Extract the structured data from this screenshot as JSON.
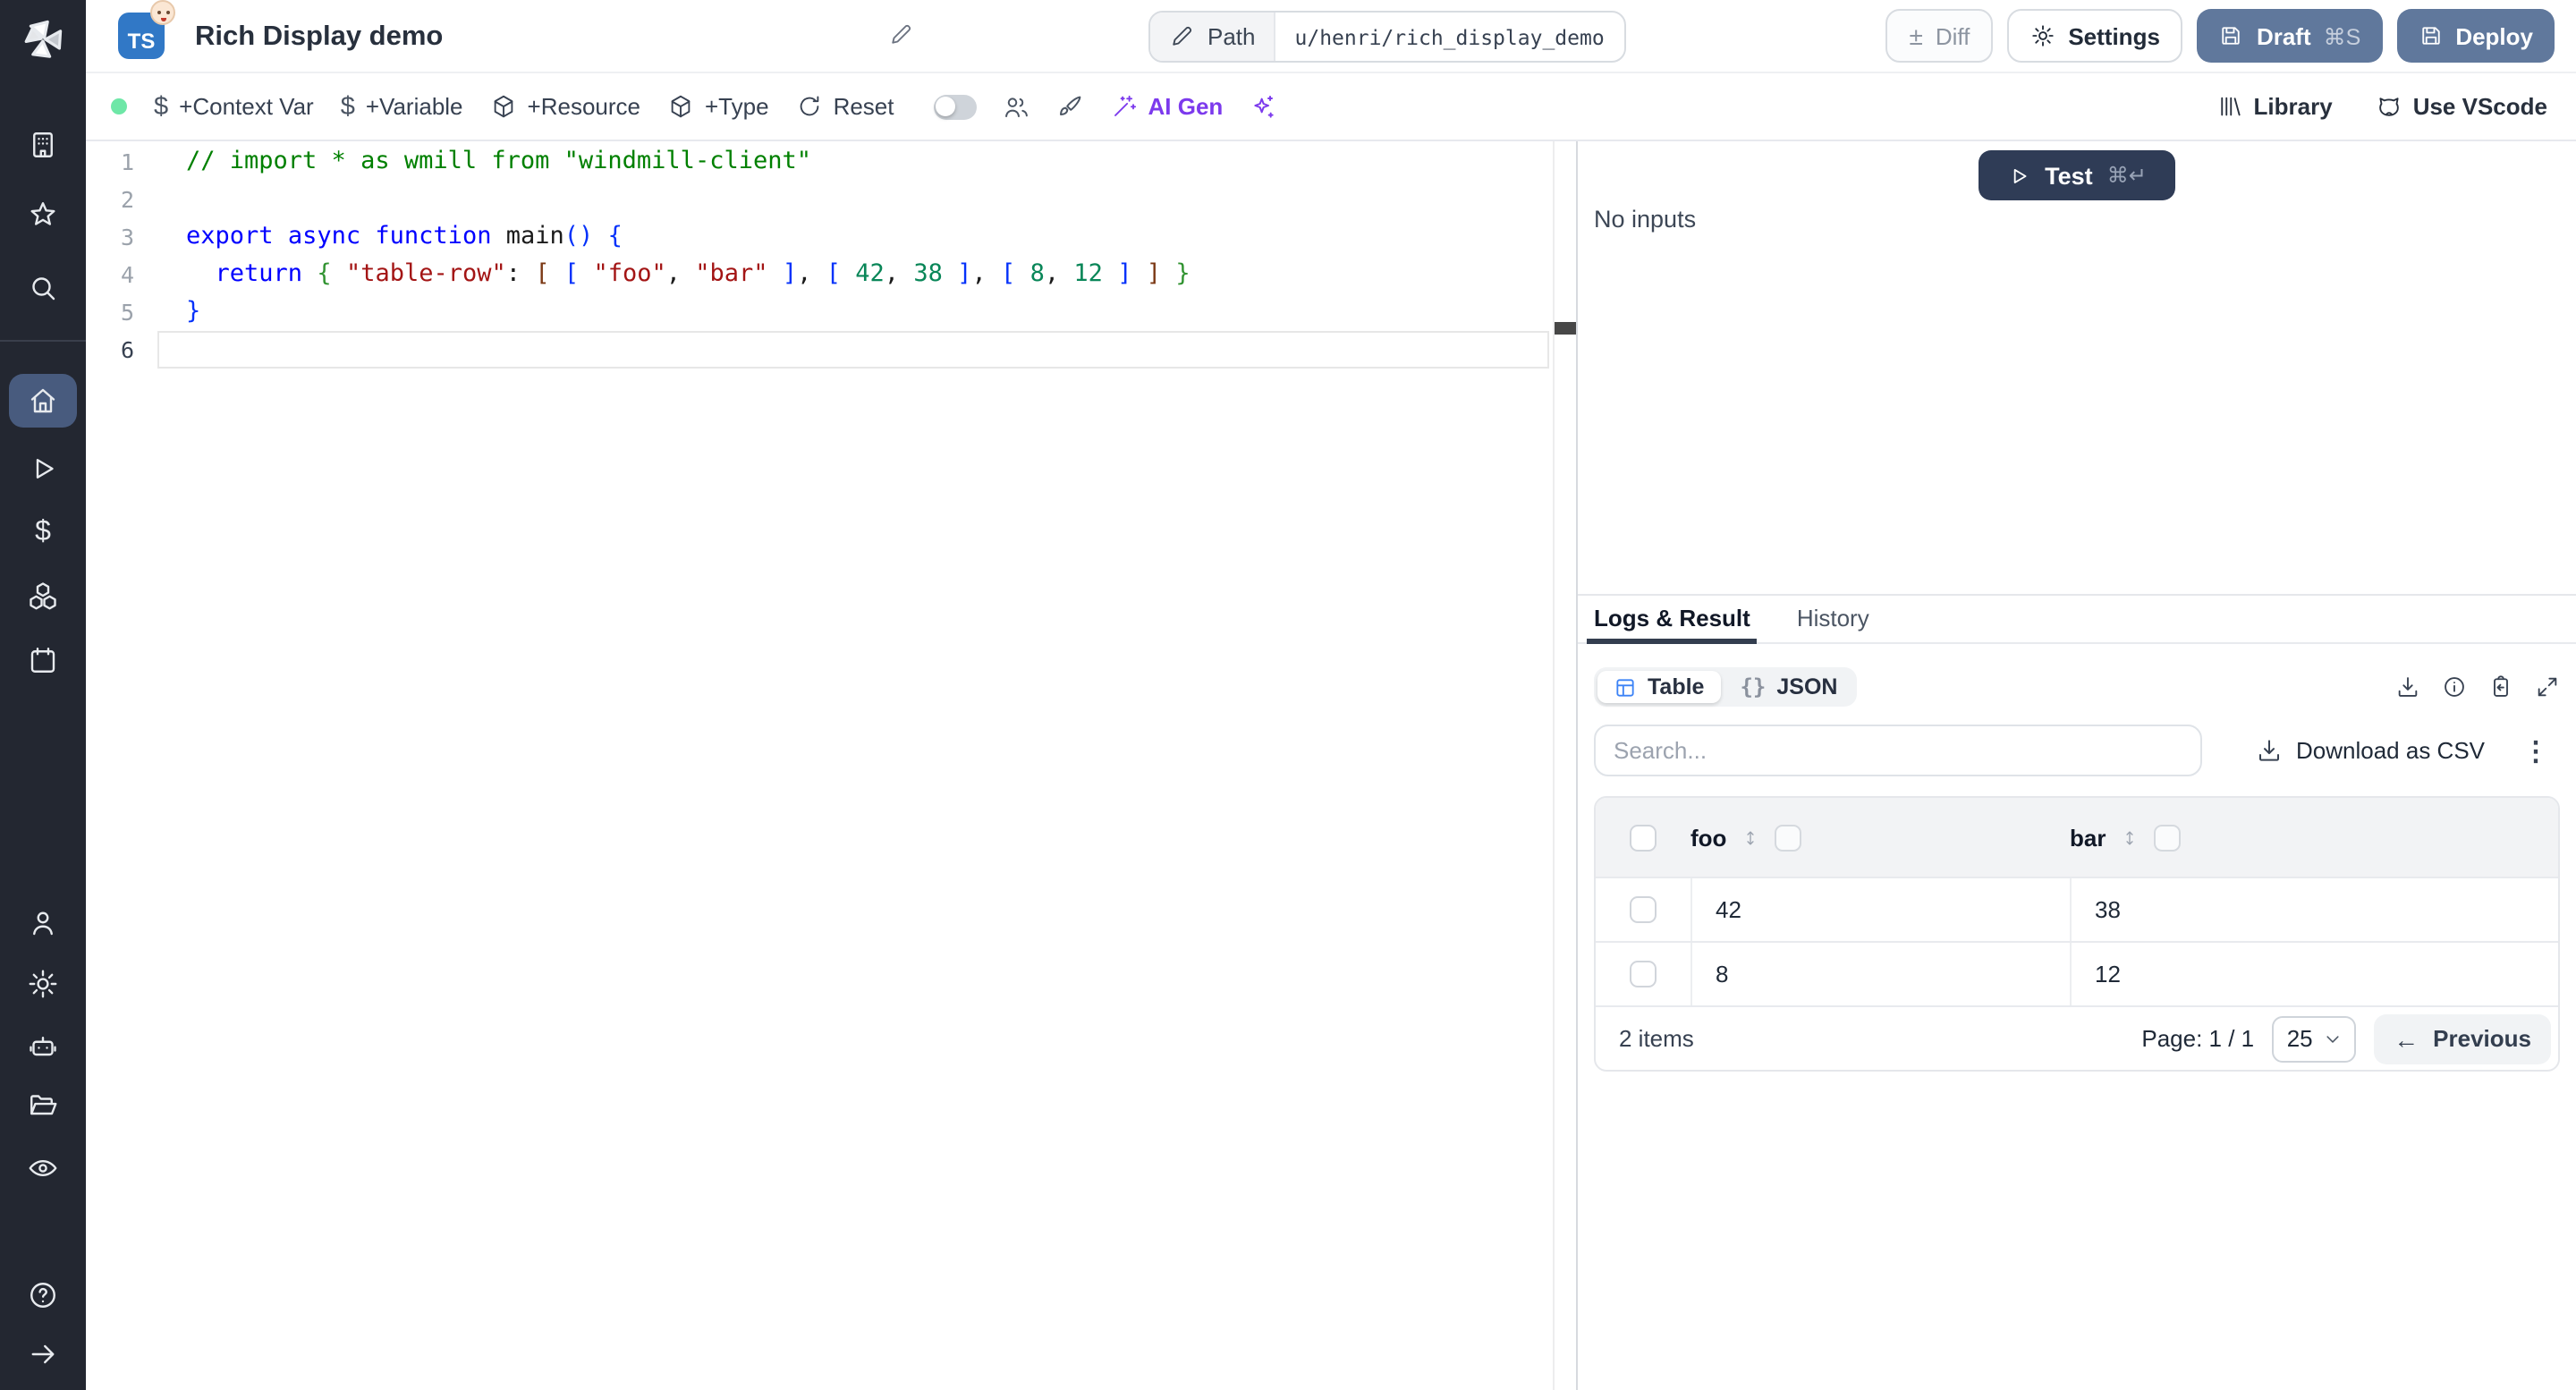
{
  "header": {
    "lang_badge": "TS",
    "title": "Rich Display demo",
    "path_label": "Path",
    "path_value": "u/henri/rich_display_demo",
    "diff_label": "Diff",
    "settings_label": "Settings",
    "draft_label": "Draft",
    "draft_shortcut": "⌘S",
    "deploy_label": "Deploy"
  },
  "toolbar": {
    "context_var": "+Context Var",
    "variable": "+Variable",
    "resource": "+Resource",
    "type": "+Type",
    "reset": "Reset",
    "ai_gen": "AI Gen",
    "library": "Library",
    "vscode": "Use VScode",
    "dollar_icon": "$"
  },
  "icons": {
    "diff": "±",
    "kebab": "⋮",
    "json_braces": "{}",
    "prev_arrow": "←"
  },
  "editor": {
    "lines": [
      {
        "n": "1",
        "tokens": [
          [
            "// import * as wmill from \"windmill-client\"",
            "c"
          ]
        ]
      },
      {
        "n": "2",
        "tokens": []
      },
      {
        "n": "3",
        "tokens": [
          [
            "export",
            "k"
          ],
          [
            " ",
            "p"
          ],
          [
            "async",
            "k"
          ],
          [
            " ",
            "p"
          ],
          [
            "function",
            "k"
          ],
          [
            " ",
            "p"
          ],
          [
            "main",
            "p"
          ],
          [
            "()",
            "b1"
          ],
          [
            " ",
            "p"
          ],
          [
            "{",
            "b1"
          ]
        ]
      },
      {
        "n": "4",
        "tokens": [
          [
            "  ",
            "p"
          ],
          [
            "return",
            "k"
          ],
          [
            " ",
            "p"
          ],
          [
            "{",
            "b2"
          ],
          [
            " ",
            "p"
          ],
          [
            "\"table-row\"",
            "s"
          ],
          [
            ":",
            "p"
          ],
          [
            " ",
            "p"
          ],
          [
            "[",
            "b3"
          ],
          [
            " ",
            "p"
          ],
          [
            "[",
            "b1"
          ],
          [
            " ",
            "p"
          ],
          [
            "\"foo\"",
            "s"
          ],
          [
            ",",
            "p"
          ],
          [
            " ",
            "p"
          ],
          [
            "\"bar\"",
            "s"
          ],
          [
            " ",
            "p"
          ],
          [
            "]",
            "b1"
          ],
          [
            ",",
            "p"
          ],
          [
            " ",
            "p"
          ],
          [
            "[",
            "b1"
          ],
          [
            " ",
            "p"
          ],
          [
            "42",
            "n"
          ],
          [
            ",",
            "p"
          ],
          [
            " ",
            "p"
          ],
          [
            "38",
            "n"
          ],
          [
            " ",
            "p"
          ],
          [
            "]",
            "b1"
          ],
          [
            ",",
            "p"
          ],
          [
            " ",
            "p"
          ],
          [
            "[",
            "b1"
          ],
          [
            " ",
            "p"
          ],
          [
            "8",
            "n"
          ],
          [
            ",",
            "p"
          ],
          [
            " ",
            "p"
          ],
          [
            "12",
            "n"
          ],
          [
            " ",
            "p"
          ],
          [
            "]",
            "b1"
          ],
          [
            " ",
            "p"
          ],
          [
            "]",
            "b3"
          ],
          [
            " ",
            "p"
          ],
          [
            "}",
            "b2"
          ]
        ]
      },
      {
        "n": "5",
        "tokens": [
          [
            "}",
            "b1"
          ]
        ]
      },
      {
        "n": "6",
        "tokens": [],
        "current": true
      }
    ]
  },
  "run_panel": {
    "test_label": "Test",
    "test_shortcut": "⌘↵",
    "no_inputs": "No inputs"
  },
  "result_panel": {
    "tab_logs": "Logs & Result",
    "tab_history": "History",
    "view_table": "Table",
    "view_json": "JSON",
    "search_placeholder": "Search...",
    "download_csv": "Download as CSV"
  },
  "table": {
    "columns": [
      "foo",
      "bar"
    ],
    "rows": [
      [
        "42",
        "38"
      ],
      [
        "8",
        "12"
      ]
    ],
    "summary": "2 items",
    "page_label": "Page: 1 / 1",
    "page_size": "25",
    "previous_label": "Previous"
  },
  "colors": {
    "accent_blue": "#3b82f6",
    "brand_purple": "#7c3aed",
    "status_green": "#6ee7a7",
    "button_slate": "#60789c",
    "test_navy": "#2f3c56",
    "sidebar_dark": "#232731"
  }
}
